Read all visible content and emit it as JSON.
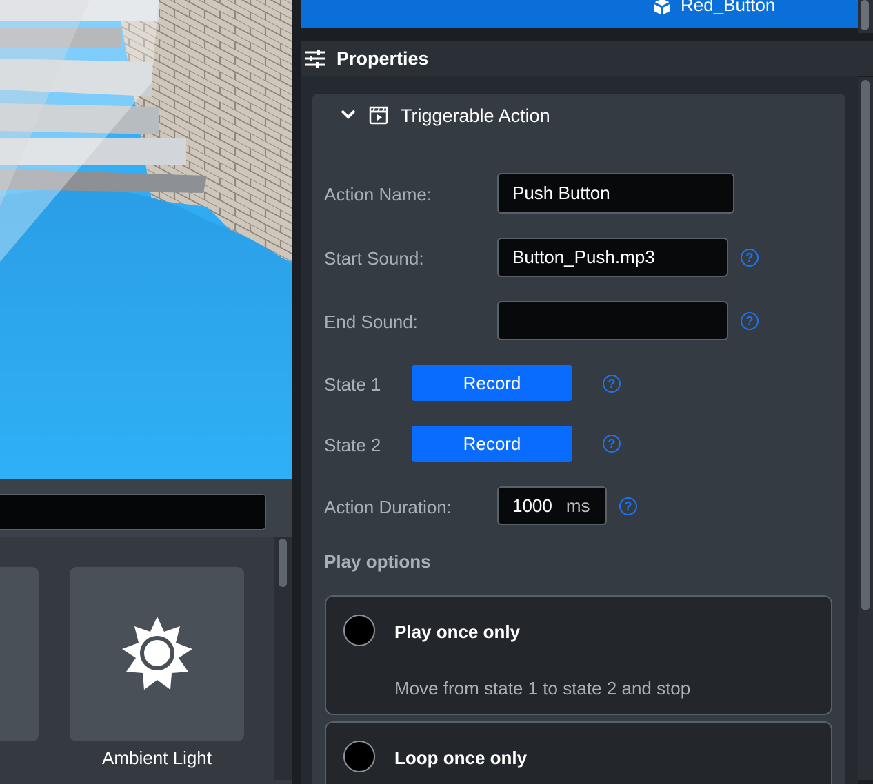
{
  "outliner": {
    "selected_item": "Red_Button"
  },
  "properties": {
    "title": "Properties",
    "section_title": "Triggerable Action",
    "action_name_label": "Action Name:",
    "action_name_value": "Push Button",
    "start_sound_label": "Start Sound:",
    "start_sound_value": "Button_Push.mp3",
    "end_sound_label": "End Sound:",
    "end_sound_value": "",
    "state1_label": "State 1",
    "state2_label": "State 2",
    "record_label": "Record",
    "action_duration_label": "Action Duration:",
    "action_duration_value": "1000",
    "action_duration_unit": "ms",
    "help_glyph": "?",
    "play_options_label": "Play options",
    "options": [
      {
        "title": "Play once only",
        "description": "Move from state 1 to state 2 and stop"
      },
      {
        "title": "Loop once only",
        "description": ""
      }
    ]
  },
  "assets": {
    "tiles": [
      {
        "label": "Ambient Light",
        "icon": "sun-icon"
      }
    ]
  },
  "colors": {
    "accent": "#0a6cff",
    "selection": "#0a6fd8",
    "help": "#1b74ee"
  }
}
